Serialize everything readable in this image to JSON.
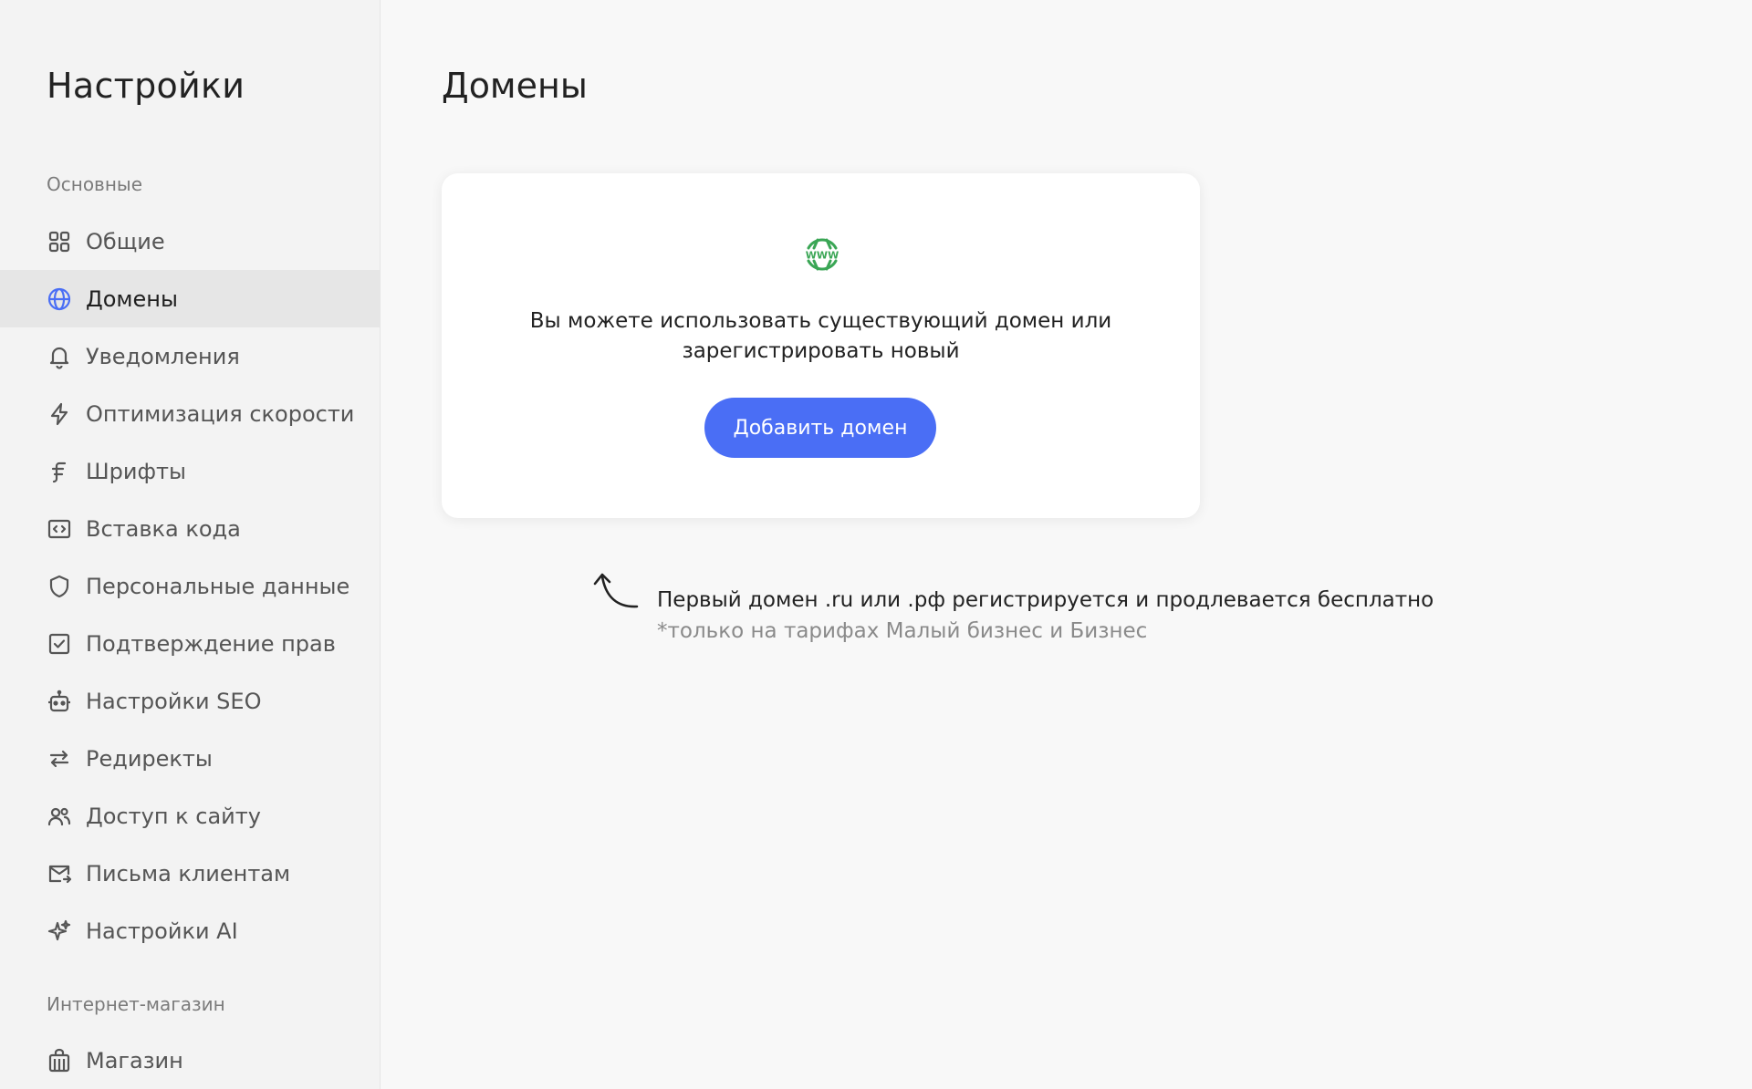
{
  "sidebar": {
    "title": "Настройки",
    "sections": [
      {
        "label": "Основные"
      },
      {
        "label": "Интернет-магазин"
      }
    ],
    "items": [
      {
        "label": "Общие",
        "icon": "grid-icon"
      },
      {
        "label": "Домены",
        "icon": "globe-icon",
        "active": true
      },
      {
        "label": "Уведомления",
        "icon": "bell-icon"
      },
      {
        "label": "Оптимизация скорости",
        "icon": "lightning-icon"
      },
      {
        "label": "Шрифты",
        "icon": "font-icon"
      },
      {
        "label": "Вставка кода",
        "icon": "code-icon"
      },
      {
        "label": "Персональные данные",
        "icon": "shield-icon"
      },
      {
        "label": "Подтверждение прав",
        "icon": "checkbox-icon"
      },
      {
        "label": "Настройки SEO",
        "icon": "robot-icon"
      },
      {
        "label": "Редиректы",
        "icon": "arrows-swap-icon"
      },
      {
        "label": "Доступ к сайту",
        "icon": "users-icon"
      },
      {
        "label": "Письма клиентам",
        "icon": "mail-icon"
      },
      {
        "label": "Настройки AI",
        "icon": "sparkle-icon"
      },
      {
        "label": "Магазин",
        "icon": "shop-icon"
      }
    ]
  },
  "main": {
    "title": "Домены",
    "card": {
      "icon": "www-globe-icon",
      "text": "Вы можете использовать существующий домен или зарегистрировать новый",
      "button_label": "Добавить домен"
    },
    "hint": {
      "main": "Первый домен .ru или .рф регистрируется и продлевается бесплатно",
      "sub": "*только на тарифах Малый бизнес и Бизнес"
    }
  },
  "colors": {
    "accent": "#4a6ef5",
    "www_icon": "#3aa655",
    "sidebar_bg": "#f3f3f3",
    "active_item_bg": "#e6e6e6",
    "page_bg": "#f8f8f8"
  }
}
